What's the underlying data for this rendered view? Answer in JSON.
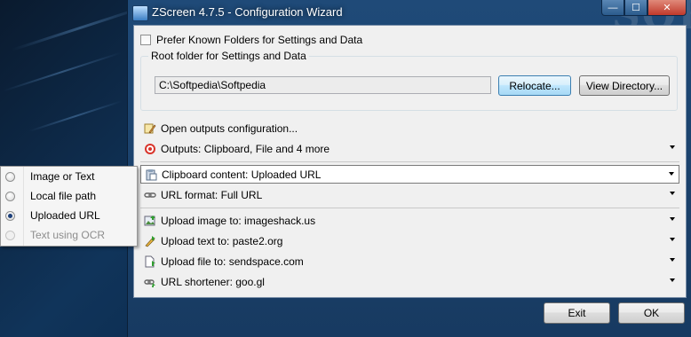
{
  "window": {
    "title": "ZScreen 4.7.5 - Configuration Wizard",
    "minimize_glyph": "—",
    "maximize_glyph": "☐",
    "close_glyph": "✕"
  },
  "watermark": "SOFTPE",
  "settings": {
    "prefer_known_folders_label": "Prefer Known Folders for Settings and Data",
    "prefer_known_folders_checked": false,
    "root_group_label": "Root folder for Settings and Data",
    "root_path_value": "C:\\Softpedia\\Softpedia",
    "relocate_button": "Relocate...",
    "view_directory_button": "View Directory..."
  },
  "menu": {
    "open_outputs": {
      "label": "Open outputs configuration...",
      "icon": "gear-pencil-icon"
    },
    "outputs": {
      "label": "Outputs: Clipboard, File and 4 more",
      "icon": "target-icon"
    },
    "clipboard_content": {
      "label": "Clipboard content: Uploaded URL",
      "icon": "clipboard-icon"
    },
    "url_format": {
      "label": "URL format: Full URL",
      "icon": "link-icon"
    },
    "upload_image": {
      "label": "Upload image to: imageshack.us",
      "icon": "image-upload-icon"
    },
    "upload_text": {
      "label": "Upload text to: paste2.org",
      "icon": "text-upload-icon"
    },
    "upload_file": {
      "label": "Upload file to: sendspace.com",
      "icon": "file-upload-icon"
    },
    "url_shortener": {
      "label": "URL shortener: goo.gl",
      "icon": "shortener-icon"
    }
  },
  "footer": {
    "exit_button": "Exit",
    "ok_button": "OK"
  },
  "popup": {
    "options": [
      {
        "label": "Image or Text",
        "selected": false,
        "enabled": true
      },
      {
        "label": "Local file path",
        "selected": false,
        "enabled": true
      },
      {
        "label": "Uploaded URL",
        "selected": true,
        "enabled": true
      },
      {
        "label": "Text using OCR",
        "selected": false,
        "enabled": false
      }
    ]
  },
  "colors": {
    "desktop": "#10345a",
    "titlebar": "#1f4a78",
    "client_bg": "#f0f0f0",
    "close_button": "#c0392b",
    "hot_button": "#bee6fd"
  }
}
